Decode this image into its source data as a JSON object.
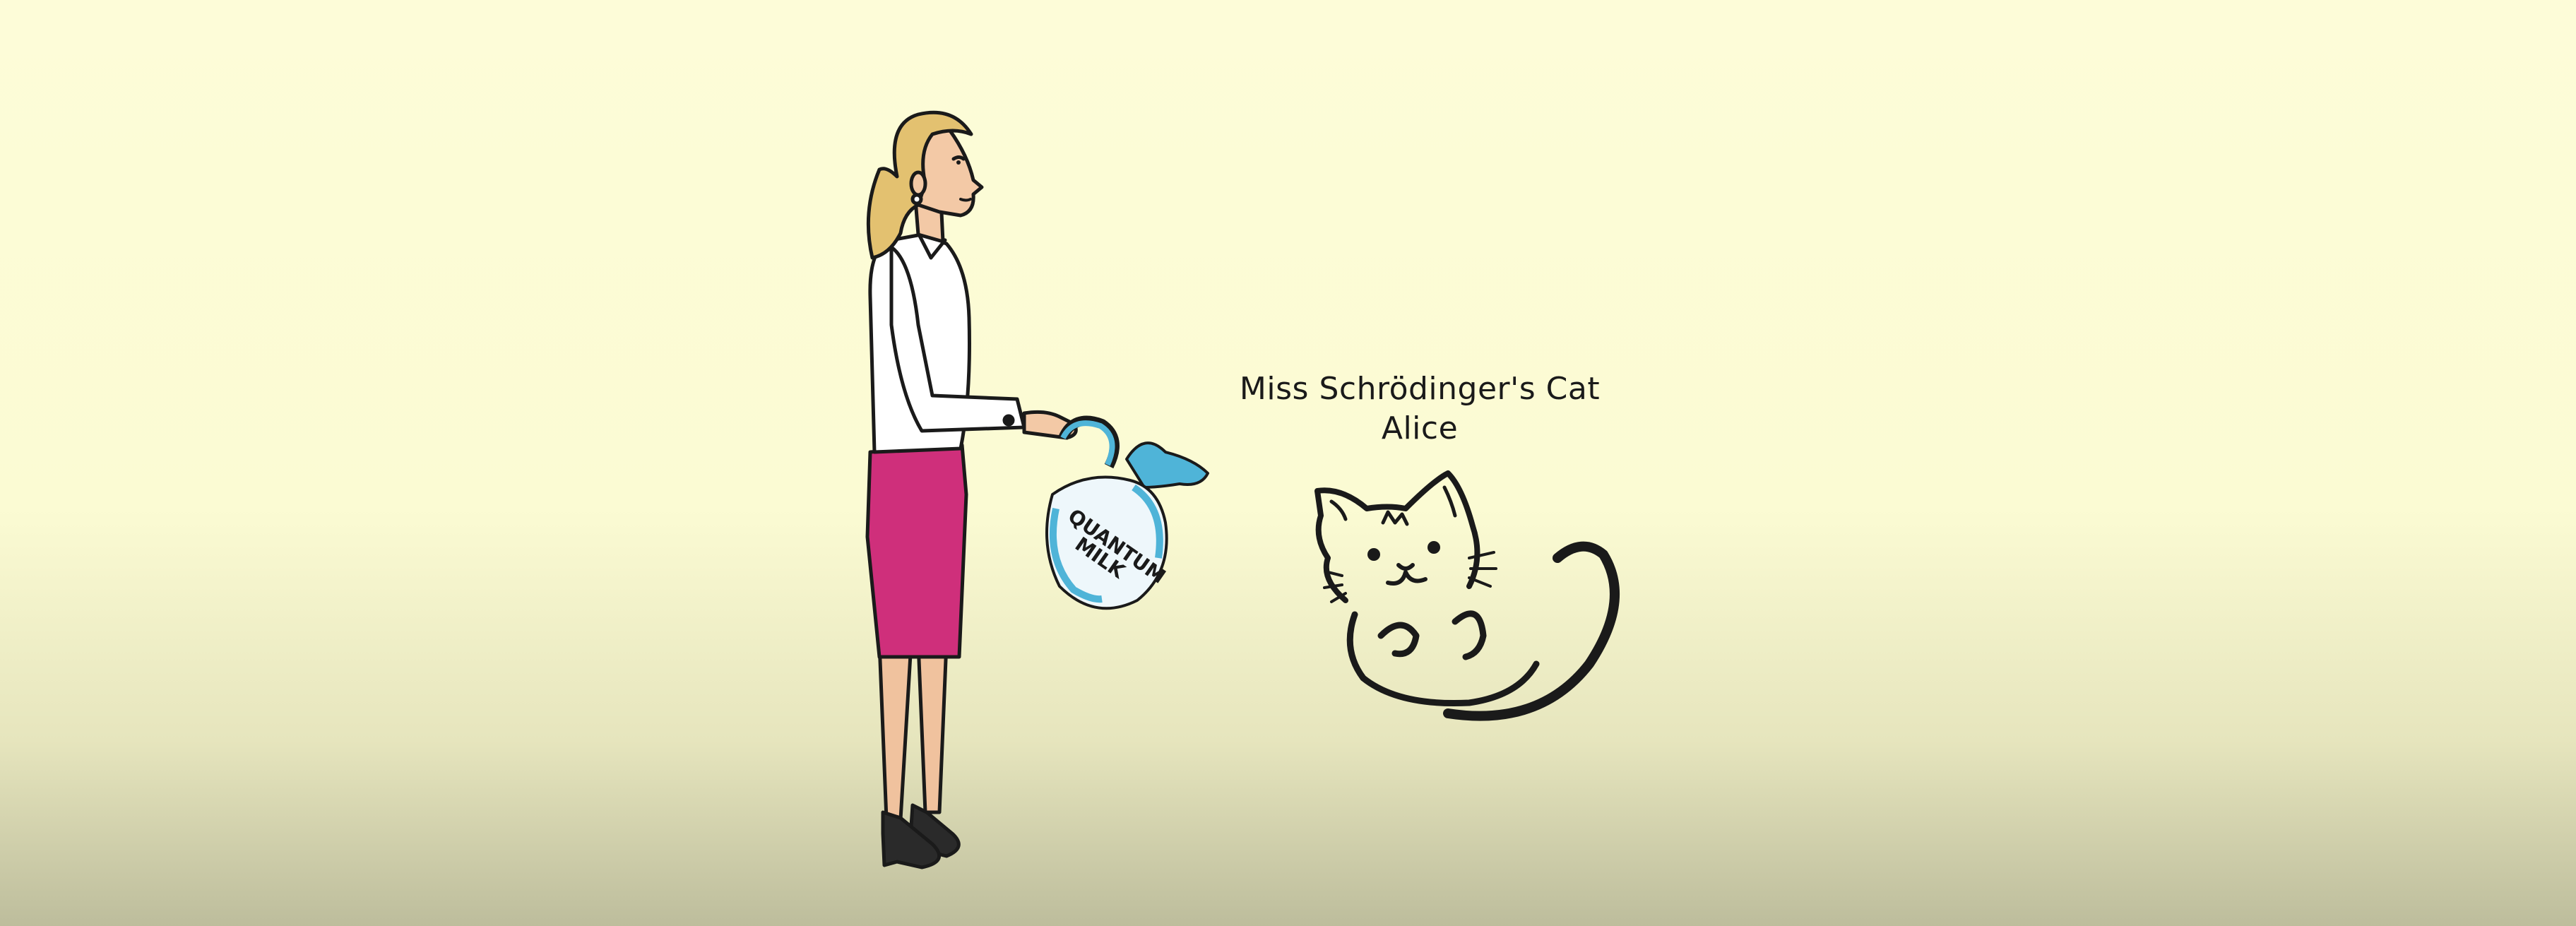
{
  "caption": {
    "line1": "Miss Schrödinger's Cat",
    "line2": "Alice"
  },
  "jug": {
    "label_line1": "QUANTUM",
    "label_line2": "MILK"
  },
  "colors": {
    "background_top": "#fdfcd8",
    "background_bottom": "#bdbd9c",
    "hair": "#e3c170",
    "skirt": "#cf2f7b",
    "shirt": "#ffffff",
    "skin": "#f3c9a6",
    "milk": "#4fb4d8",
    "outline": "#1a1a1a"
  }
}
